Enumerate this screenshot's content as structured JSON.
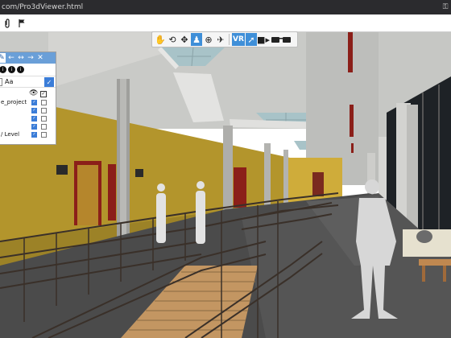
{
  "browser": {
    "url": "com/Pro3dViewer.html",
    "key_icon": "key-icon"
  },
  "toolbar": {
    "icons": [
      "paperclip-icon",
      "flag-icon"
    ]
  },
  "navigation": {
    "tools": [
      {
        "name": "hand-pan-icon",
        "active": false
      },
      {
        "name": "orbit-icon",
        "active": false
      },
      {
        "name": "move-arrows-icon",
        "active": false
      },
      {
        "name": "walk-bell-icon",
        "active": true
      },
      {
        "name": "look-around-icon",
        "active": false
      },
      {
        "name": "fly-icon",
        "active": false
      }
    ],
    "vr_label": "VR",
    "vr_active": true,
    "extra_tools": [
      {
        "name": "pointer-icon",
        "active": true
      },
      {
        "name": "video-camera-icon",
        "active": false
      },
      {
        "name": "glasses-icon",
        "active": false
      }
    ]
  },
  "layers_panel": {
    "header_icons": [
      "edit-icon",
      "arrow-left-icon",
      "expand-horizontal-icon",
      "arrow-right-icon",
      "close-icon"
    ],
    "info_icons": [
      "info-circle-icon-1",
      "info-circle-icon-2",
      "info-circle-icon-3"
    ],
    "font_label": "Aa",
    "font_checked": true,
    "layers": [
      {
        "label": "e_project",
        "visible": true,
        "selected": false
      },
      {
        "label": "",
        "visible": true,
        "selected": false
      },
      {
        "label": "",
        "visible": true,
        "selected": false
      },
      {
        "label": "",
        "visible": true,
        "selected": false
      },
      {
        "label": "/ Level",
        "visible": true,
        "selected": false
      }
    ]
  },
  "colors": {
    "accent": "#3f8fd8",
    "panel_header": "#6a9fd8",
    "wall_yellow": "#b3952c",
    "door_red": "#8b1f19",
    "floor": "#4b4b4b",
    "sky_glass": "#a8c3c8"
  }
}
